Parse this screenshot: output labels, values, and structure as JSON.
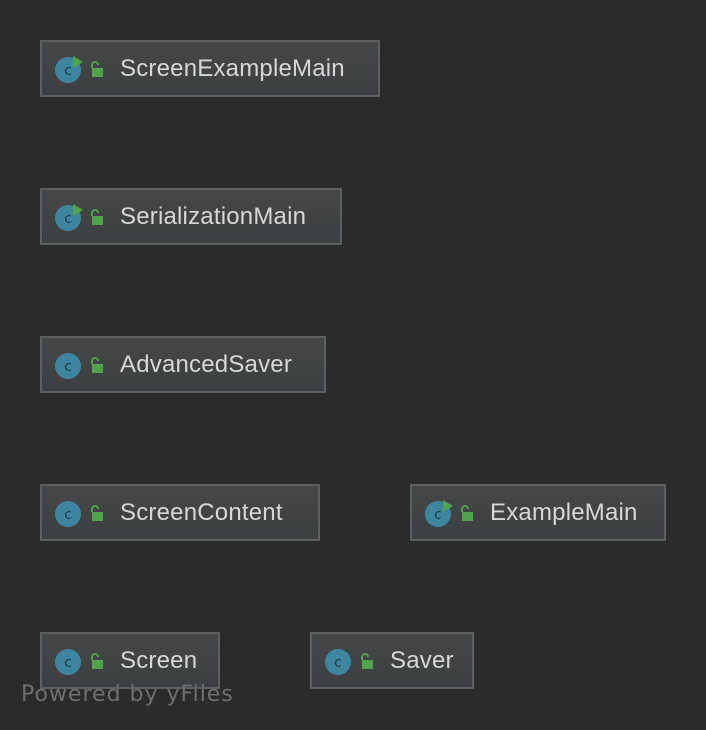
{
  "diagram": {
    "nodes": [
      {
        "id": "screen-example-main",
        "label": "ScreenExampleMain",
        "kind": "class",
        "runnable": true
      },
      {
        "id": "serialization-main",
        "label": "SerializationMain",
        "kind": "class",
        "runnable": true
      },
      {
        "id": "advanced-saver",
        "label": "AdvancedSaver",
        "kind": "class",
        "runnable": false
      },
      {
        "id": "screen-content",
        "label": "ScreenContent",
        "kind": "class",
        "runnable": false
      },
      {
        "id": "example-main",
        "label": "ExampleMain",
        "kind": "class",
        "runnable": true
      },
      {
        "id": "screen",
        "label": "Screen",
        "kind": "class",
        "runnable": false
      },
      {
        "id": "saver",
        "label": "Saver",
        "kind": "class",
        "runnable": false
      }
    ]
  },
  "watermark": "Powered by yFiles",
  "colors": {
    "background": "#2b2b2b",
    "node_fill": "#3c3f41",
    "node_border": "#5e6060",
    "class_icon": "#3e86a0",
    "run_marker": "#4fa54a",
    "lock": "#4fa54a",
    "label_text": "#d7d7d7",
    "watermark_text": "#6f6f6f"
  },
  "icons": {
    "class": "class-c-icon",
    "run": "run-arrow-icon",
    "access": "public-lock-icon"
  }
}
